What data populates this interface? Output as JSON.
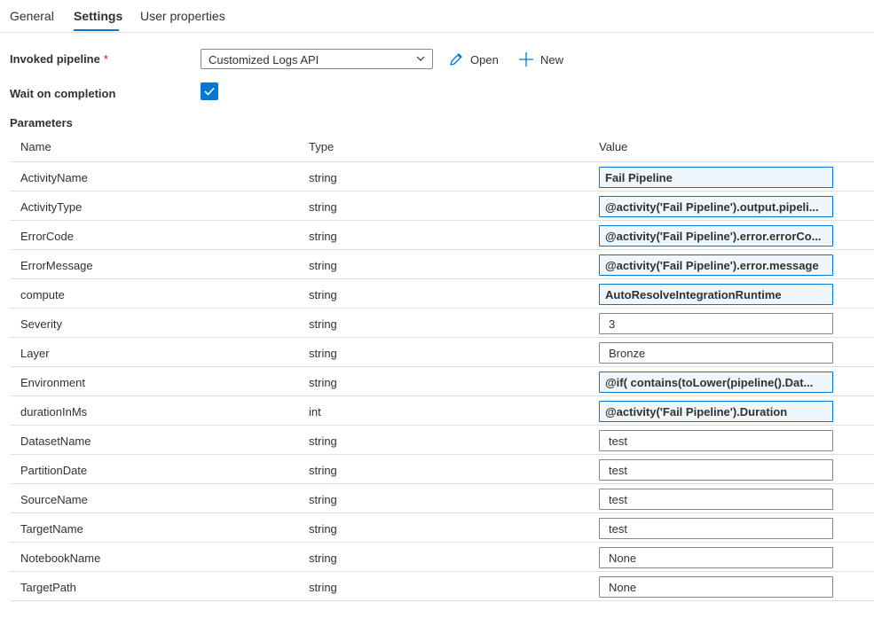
{
  "tabs": [
    {
      "label": "General"
    },
    {
      "label": "Settings"
    },
    {
      "label": "User properties"
    }
  ],
  "invoked_pipeline": {
    "label": "Invoked pipeline",
    "required_mark": "*",
    "selected": "Customized Logs API",
    "open_label": "Open",
    "new_label": "New"
  },
  "wait_on_completion": {
    "label": "Wait on completion",
    "checked": true
  },
  "parameters": {
    "title": "Parameters",
    "headers": {
      "name": "Name",
      "type": "Type",
      "value": "Value"
    },
    "rows": [
      {
        "name": "ActivityName",
        "type": "string",
        "value": "Fail Pipeline",
        "expression": true
      },
      {
        "name": "ActivityType",
        "type": "string",
        "value": "@activity('Fail Pipeline').output.pipeli...",
        "expression": true
      },
      {
        "name": "ErrorCode",
        "type": "string",
        "value": "@activity('Fail Pipeline').error.errorCo...",
        "expression": true
      },
      {
        "name": "ErrorMessage",
        "type": "string",
        "value": "@activity('Fail Pipeline').error.message",
        "expression": true
      },
      {
        "name": "compute",
        "type": "string",
        "value": "AutoResolveIntegrationRuntime",
        "expression": true
      },
      {
        "name": "Severity",
        "type": "string",
        "value": "3",
        "expression": false
      },
      {
        "name": "Layer",
        "type": "string",
        "value": "Bronze",
        "expression": false
      },
      {
        "name": "Environment",
        "type": "string",
        "value": "@if( contains(toLower(pipeline().Dat...",
        "expression": true
      },
      {
        "name": "durationInMs",
        "type": "int",
        "value": "@activity('Fail Pipeline').Duration",
        "expression": true
      },
      {
        "name": "DatasetName",
        "type": "string",
        "value": "test",
        "expression": false
      },
      {
        "name": "PartitionDate",
        "type": "string",
        "value": "test",
        "expression": false
      },
      {
        "name": "SourceName",
        "type": "string",
        "value": "test",
        "expression": false
      },
      {
        "name": "TargetName",
        "type": "string",
        "value": "test",
        "expression": false
      },
      {
        "name": "NotebookName",
        "type": "string",
        "value": "None",
        "expression": false
      },
      {
        "name": "TargetPath",
        "type": "string",
        "value": "None",
        "expression": false
      }
    ]
  },
  "colors": {
    "accent": "#0078d4",
    "expression_bg": "#eff6fc",
    "required": "#a4262c",
    "border": "#8a8886",
    "divider": "#e1dfdd"
  }
}
